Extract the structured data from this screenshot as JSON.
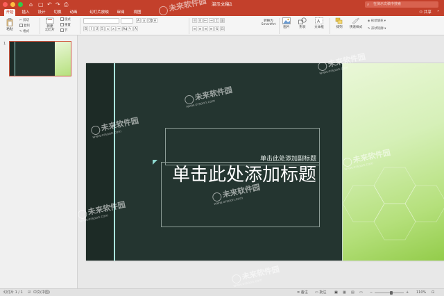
{
  "window": {
    "title": "演示文稿1",
    "quick_access": [
      "⌂",
      "▢",
      "↶",
      "↷",
      "⎙"
    ]
  },
  "search": {
    "placeholder": "在演示文稿中搜索"
  },
  "tabs": [
    {
      "label": "开始",
      "active": true
    },
    {
      "label": "插入",
      "active": false
    },
    {
      "label": "设计",
      "active": false
    },
    {
      "label": "切换",
      "active": false
    },
    {
      "label": "动画",
      "active": false
    },
    {
      "label": "幻灯片放映",
      "active": false
    },
    {
      "label": "审阅",
      "active": false
    },
    {
      "label": "视图",
      "active": false
    }
  ],
  "share_label": "共享",
  "ribbon": {
    "paste": "粘贴",
    "cut": "剪切",
    "copy": "复制",
    "format": "格式",
    "new_slide": "新建\n幻灯片",
    "layout": "版式",
    "reset": "重置",
    "section": "节",
    "convert_smartart": "转换为\nSmartArt",
    "picture": "图片",
    "shapes": "形状",
    "textbox": "文本框",
    "arrange": "排列",
    "quick_styles": "快速样式",
    "shape_fill": "形状填充",
    "shape_outline": "形状轮廓"
  },
  "slides_panel": {
    "slide_number": "1"
  },
  "slide": {
    "subtitle_placeholder": "单击此处添加副标题",
    "title_placeholder": "单击此处添加标题"
  },
  "watermark": {
    "brand": "未来软件园",
    "url": "www.orsoon.com"
  },
  "status": {
    "slide_of": "幻灯片 1 / 1",
    "language": "中文(中国)",
    "notes": "备注",
    "comments": "批注",
    "zoom": "110%"
  },
  "colors": {
    "accent": "#c3402b",
    "slide_bg": "#243530",
    "slide_accent_line": "#a9e4dd",
    "slide_right_green": "#b5e07c"
  }
}
